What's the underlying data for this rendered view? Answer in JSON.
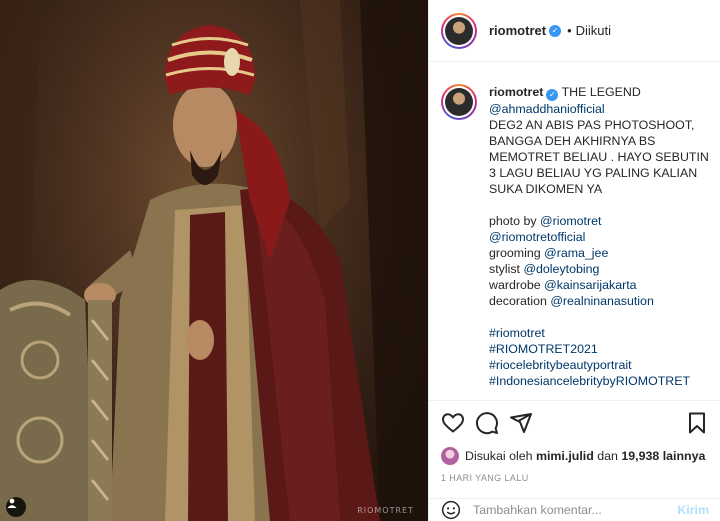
{
  "photo": {
    "watermark": "RIOMOTRET"
  },
  "header": {
    "username": "riomotret",
    "separator": "•",
    "follow_status": "Diikuti"
  },
  "caption": {
    "username": "riomotret",
    "lines": [
      "THE LEGEND",
      "@ahmaddhaniofficial",
      "DEG2 AN ABIS PAS PHOTOSHOOT,",
      "BANGGA DEH AKHIRNYA BS",
      "MEMOTRET BELIAU . HAYO SEBUTIN",
      "3 LAGU BELIAU YG PALING KALIAN",
      "SUKA DIKOMEN YA"
    ],
    "credits": {
      "photo_label": "photo by",
      "photo_mention_1": "@riomotret",
      "photo_mention_2": "@riomotretofficial",
      "grooming_label": "grooming",
      "grooming_mention": "@rama_jee",
      "stylist_label": "stylist",
      "stylist_mention": "@doleytobing",
      "wardrobe_label": "wardrobe",
      "wardrobe_mention": "@kainsarijakarta",
      "decoration_label": "decoration",
      "decoration_mention": "@realninanasution"
    },
    "hashtags": [
      "#riomotret",
      "#RIOMOTRET2021",
      "#riocelebritybeautyportrait",
      "#IndonesiancelebritybyRIOMOTRET"
    ]
  },
  "likes": {
    "prefix": "Disukai oleh",
    "user": "mimi.julid",
    "connector": "dan",
    "count": "19,938 lainnya"
  },
  "timestamp": "1 HARI YANG LALU",
  "comment_box": {
    "placeholder": "Tambahkan komentar...",
    "post_label": "Kirim"
  },
  "icons": {
    "like": "heart-icon",
    "comment": "comment-icon",
    "share": "share-icon",
    "save": "bookmark-icon",
    "emoji": "smiley-icon",
    "verified": "verified-badge-icon",
    "tag": "user-tag-icon"
  },
  "colors": {
    "link": "#00376b",
    "verified": "#3897f0",
    "muted": "#8e8e8e",
    "post_button": "#b2dffc"
  }
}
